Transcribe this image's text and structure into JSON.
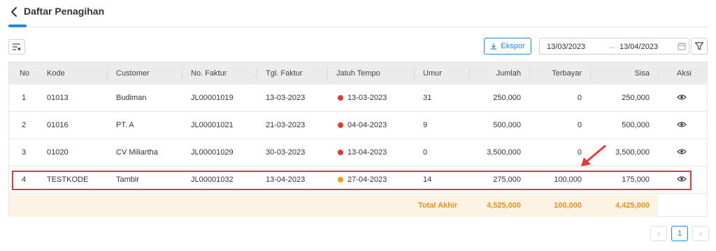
{
  "header": {
    "title": "Daftar Penagihan"
  },
  "toolbar": {
    "export_label": "Ekspor",
    "date_start": "13/03/2023",
    "date_end": "13/04/2023",
    "date_separator": "→"
  },
  "table": {
    "columns": [
      "No",
      "Kode",
      "Customer",
      "No. Faktur",
      "Tgl. Faktur",
      "Jatuh Tempo",
      "Umur",
      "Jumlah",
      "Terbayar",
      "Sisa",
      "Aksi"
    ],
    "rows": [
      {
        "no": "1",
        "kode": "01013",
        "customer": "Budiman",
        "faktur": "JL00001019",
        "tgl": "13-03-2023",
        "jatuh_tempo": "13-03-2023",
        "status_color": "#e53935",
        "umur": "31",
        "jumlah": "250,000",
        "terbayar": "0",
        "sisa": "250,000"
      },
      {
        "no": "2",
        "kode": "01016",
        "customer": "PT. A",
        "faktur": "JL00001021",
        "tgl": "21-03-2023",
        "jatuh_tempo": "04-04-2023",
        "status_color": "#e53935",
        "umur": "9",
        "jumlah": "500,000",
        "terbayar": "0",
        "sisa": "500,000"
      },
      {
        "no": "3",
        "kode": "01020",
        "customer": "CV Miliartha",
        "faktur": "JL00001029",
        "tgl": "30-03-2023",
        "jatuh_tempo": "13-04-2023",
        "status_color": "#e53935",
        "umur": "0",
        "jumlah": "3,500,000",
        "terbayar": "0",
        "sisa": "3,500,000"
      },
      {
        "no": "4",
        "kode": "TESTKODE",
        "customer": "Tambir",
        "faktur": "JL00001032",
        "tgl": "13-04-2023",
        "jatuh_tempo": "27-04-2023",
        "status_color": "#f39c12",
        "umur": "14",
        "jumlah": "275,000",
        "terbayar": "100,000",
        "sisa": "175,000"
      }
    ],
    "totals": {
      "label": "Total Akhir",
      "jumlah": "4,525,000",
      "terbayar": "100,000",
      "sisa": "4,425,000"
    }
  },
  "pagination": {
    "current_page": "1",
    "prev_icon": "chevron-left-icon",
    "next_icon": "chevron-right-icon"
  },
  "colors": {
    "accent": "#1e88e5",
    "overdue": "#e53935",
    "pending": "#f39c12",
    "total_text": "#e8911a",
    "total_bg": "#fdf3e4"
  }
}
